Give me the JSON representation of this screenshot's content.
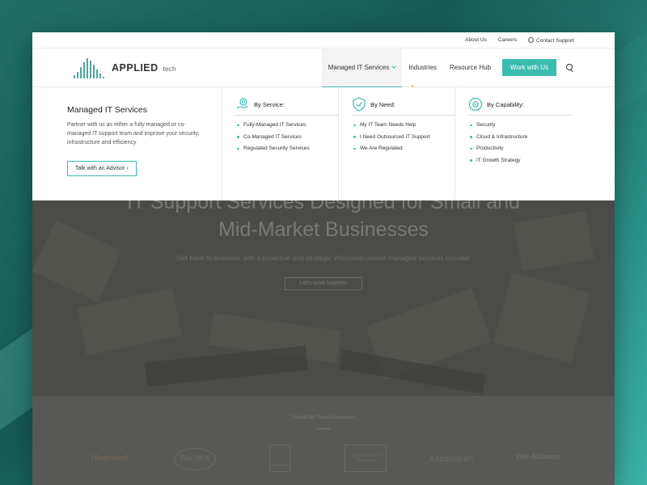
{
  "utility": {
    "about": "About Us",
    "careers": "Careers",
    "contact": "Contact Support"
  },
  "brand": {
    "name": "APPLIED",
    "suffix": "tech",
    "accent_color": "#3cbcb0"
  },
  "nav": {
    "managed": "Managed IT Services",
    "industries": "Industries",
    "resource": "Resource Hub",
    "cta": "Work with Us"
  },
  "mega": {
    "title": "Managed IT Services",
    "description": "Partner with us as either a fully managed or co-managed IT support team and improve your security, infrastructure and efficiency",
    "advisor_btn": "Talk with an Advisor",
    "columns": [
      {
        "heading": "By Service:",
        "icon": "hand-gear-icon",
        "items": [
          "Fully-Managed IT Services",
          "Co-Managed IT Services",
          "Regulated Security Services"
        ]
      },
      {
        "heading": "By Need:",
        "icon": "shield-check-icon",
        "items": [
          "My IT Team Needs Help",
          "I Need Outsourced IT Support",
          "We Are Regulated"
        ]
      },
      {
        "heading": "By Capability:",
        "icon": "gear-cycle-icon",
        "items": [
          "Security",
          "Cloud & Infrastructure",
          "Productivity",
          "IT Growth Strategy"
        ]
      }
    ]
  },
  "hero": {
    "title_line1": "IT Support Services Designed for Small and",
    "title_line2": "Mid-Market Businesses",
    "subtitle": "Get back to business with a proactive and strategic Wisconsin-based managed services provider",
    "button": "Let's work together"
  },
  "trusted": {
    "label": "Trusted By These Companies",
    "logos": [
      "Heartland",
      "BROWN",
      "Goodwill",
      "Dairy Farmers of Wisconsin",
      "Ascendium",
      "The Alliance"
    ]
  }
}
